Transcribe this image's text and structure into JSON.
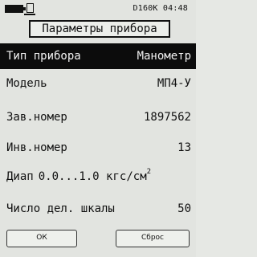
{
  "statusbar": {
    "device_code": "D160K",
    "time": "04:48"
  },
  "title": "Параметры прибора",
  "rows": [
    {
      "label": "Тип прибора",
      "value": "Манометр"
    },
    {
      "label": "Модель",
      "value": "МП4-У"
    },
    {
      "label": "Зав.номер",
      "value": "1897562"
    },
    {
      "label": "Инв.номер",
      "value": "13"
    },
    {
      "label": "Число дел. шкалы",
      "value": "50"
    }
  ],
  "range": {
    "label": "Диап",
    "from": "0.0",
    "separator": "...",
    "to": "1.0",
    "unit": "кгс/см",
    "unit_superscript": "2"
  },
  "buttons": {
    "ok_label": "ОК",
    "reset_label": "Сброс"
  },
  "selected_row": "Тип прибора"
}
